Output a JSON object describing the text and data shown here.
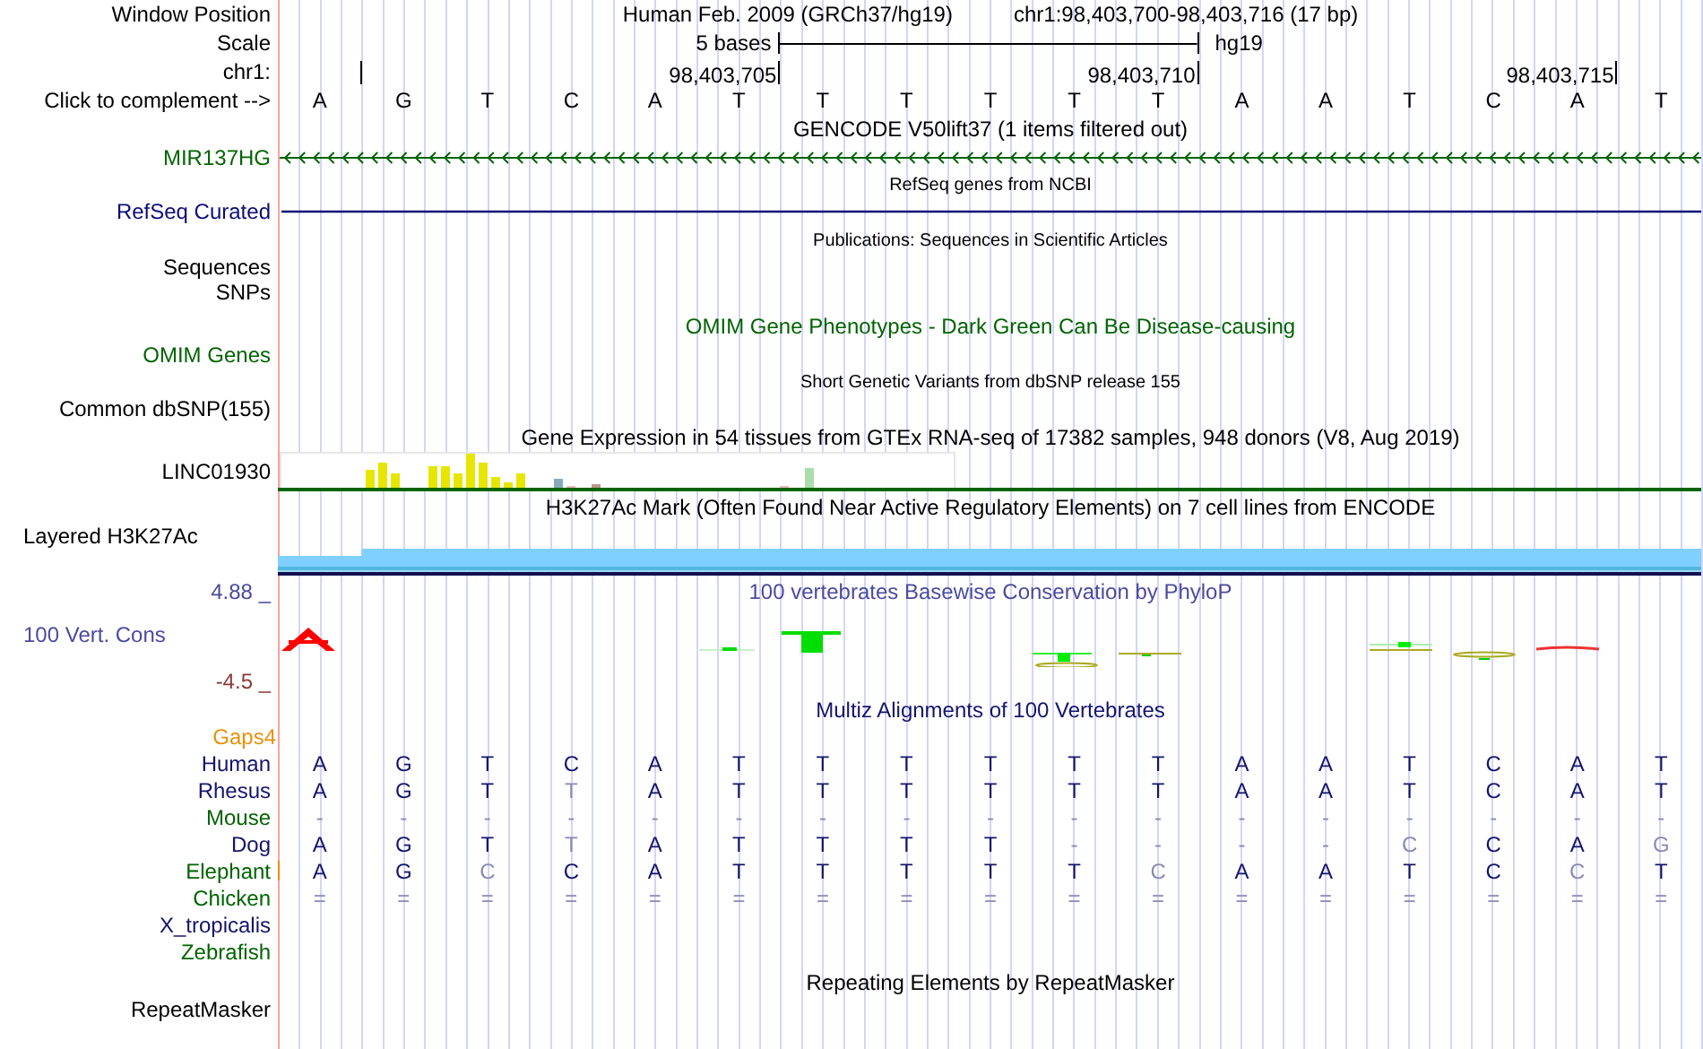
{
  "header": {
    "label": "Window Position",
    "assembly": "Human Feb. 2009 (GRCh37/hg19)",
    "position": "chr1:98,403,700-98,403,716 (17 bp)"
  },
  "scale": {
    "label": "Scale",
    "span": "5 bases",
    "assembly": "hg19"
  },
  "ruler": {
    "label": "chr1:",
    "ticks": [
      "98,403,705",
      "98,403,710",
      "98,403,715"
    ]
  },
  "sequence": {
    "label": "Click to complement -->",
    "bases": [
      "A",
      "G",
      "T",
      "C",
      "A",
      "T",
      "T",
      "T",
      "T",
      "T",
      "T",
      "A",
      "A",
      "T",
      "C",
      "A",
      "T"
    ]
  },
  "tracks": [
    {
      "kind": "gene",
      "title": "GENCODE V50lift37 (1 items filtered out)",
      "color": "#000000",
      "labels": [
        {
          "text": "MIR137HG",
          "color": "#006400"
        }
      ]
    },
    {
      "kind": "refseq",
      "title": "RefSeq genes from NCBI",
      "color": "#000000",
      "labels": [
        {
          "text": "RefSeq Curated",
          "color": "#0c0c78"
        }
      ]
    },
    {
      "kind": "pubs",
      "title": "Publications: Sequences in Scientific Articles",
      "color": "#000000",
      "labels": [
        {
          "text": "Sequences",
          "color": "#000000"
        },
        {
          "text": "SNPs",
          "color": "#000000"
        }
      ]
    },
    {
      "kind": "omim",
      "title": "OMIM Gene Phenotypes - Dark Green Can Be Disease-causing",
      "color": "#006400",
      "labels": [
        {
          "text": "OMIM Genes",
          "color": "#006400"
        }
      ]
    },
    {
      "kind": "dbsnp",
      "title": "Short Genetic Variants from dbSNP release 155",
      "color": "#000000",
      "labels": [
        {
          "text": "Common dbSNP(155)",
          "color": "#000000"
        }
      ]
    },
    {
      "kind": "gtex",
      "title": "Gene Expression in 54 tissues from GTEx RNA-seq of 17382 samples, 948 donors (V8, Aug 2019)",
      "color": "#000000",
      "labels": [
        {
          "text": "LINC01930",
          "color": "#000000"
        }
      ]
    },
    {
      "kind": "h3k27ac",
      "title": "H3K27Ac Mark (Often Found Near Active Regulatory Elements) on 7 cell lines from ENCODE",
      "color": "#000000",
      "labels": [
        {
          "text": "Layered H3K27Ac",
          "color": "#000000"
        }
      ]
    },
    {
      "kind": "phylop",
      "title": "100 vertebrates Basewise Conservation by PhyloP",
      "color": "#4a4aa0",
      "labels": [
        {
          "text": "4.88 _",
          "color": "#4a4aa0"
        },
        {
          "text": "100 Vert. Cons",
          "color": "#4a4aa0"
        },
        {
          "text": "-4.5 _",
          "color": "#8a3a3a"
        }
      ]
    },
    {
      "kind": "multiz",
      "title": "Multiz Alignments of 100 Vertebrates",
      "color": "#14146e",
      "labels": [
        {
          "text": "Gaps4",
          "color": "#e8900a"
        }
      ],
      "species": [
        {
          "name": "Human",
          "color": "#14146e",
          "gap": false,
          "bases": [
            {
              "b": "A",
              "dim": false
            },
            {
              "b": "G",
              "dim": false
            },
            {
              "b": "T",
              "dim": false
            },
            {
              "b": "C",
              "dim": false
            },
            {
              "b": "A",
              "dim": false
            },
            {
              "b": "T",
              "dim": false
            },
            {
              "b": "T",
              "dim": false
            },
            {
              "b": "T",
              "dim": false
            },
            {
              "b": "T",
              "dim": false
            },
            {
              "b": "T",
              "dim": false
            },
            {
              "b": "T",
              "dim": false
            },
            {
              "b": "A",
              "dim": false
            },
            {
              "b": "A",
              "dim": false
            },
            {
              "b": "T",
              "dim": false
            },
            {
              "b": "C",
              "dim": false
            },
            {
              "b": "A",
              "dim": false
            },
            {
              "b": "T",
              "dim": false
            }
          ]
        },
        {
          "name": "Rhesus",
          "color": "#14146e",
          "gap": false,
          "bases": [
            {
              "b": "A",
              "dim": false
            },
            {
              "b": "G",
              "dim": false
            },
            {
              "b": "T",
              "dim": false
            },
            {
              "b": "T",
              "dim": true
            },
            {
              "b": "A",
              "dim": false
            },
            {
              "b": "T",
              "dim": false
            },
            {
              "b": "T",
              "dim": false
            },
            {
              "b": "T",
              "dim": false
            },
            {
              "b": "T",
              "dim": false
            },
            {
              "b": "T",
              "dim": false
            },
            {
              "b": "T",
              "dim": false
            },
            {
              "b": "A",
              "dim": false
            },
            {
              "b": "A",
              "dim": false
            },
            {
              "b": "T",
              "dim": false
            },
            {
              "b": "C",
              "dim": false
            },
            {
              "b": "A",
              "dim": false
            },
            {
              "b": "T",
              "dim": false
            }
          ]
        },
        {
          "name": "Mouse",
          "color": "#006400",
          "gap": false,
          "bases": [
            {
              "b": "-",
              "dim": true
            },
            {
              "b": "-",
              "dim": true
            },
            {
              "b": "-",
              "dim": true
            },
            {
              "b": "-",
              "dim": true
            },
            {
              "b": "-",
              "dim": true
            },
            {
              "b": "-",
              "dim": true
            },
            {
              "b": "-",
              "dim": true
            },
            {
              "b": "-",
              "dim": true
            },
            {
              "b": "-",
              "dim": true
            },
            {
              "b": "-",
              "dim": true
            },
            {
              "b": "-",
              "dim": true
            },
            {
              "b": "-",
              "dim": true
            },
            {
              "b": "-",
              "dim": true
            },
            {
              "b": "-",
              "dim": true
            },
            {
              "b": "-",
              "dim": true
            },
            {
              "b": "-",
              "dim": true
            },
            {
              "b": "-",
              "dim": true
            }
          ]
        },
        {
          "name": "Dog",
          "color": "#14146e",
          "gap": false,
          "bases": [
            {
              "b": "A",
              "dim": false
            },
            {
              "b": "G",
              "dim": false
            },
            {
              "b": "T",
              "dim": false
            },
            {
              "b": "T",
              "dim": true
            },
            {
              "b": "A",
              "dim": false
            },
            {
              "b": "T",
              "dim": false
            },
            {
              "b": "T",
              "dim": false
            },
            {
              "b": "T",
              "dim": false
            },
            {
              "b": "T",
              "dim": false
            },
            {
              "b": "-",
              "dim": true
            },
            {
              "b": "-",
              "dim": true
            },
            {
              "b": "-",
              "dim": true
            },
            {
              "b": "-",
              "dim": true
            },
            {
              "b": "C",
              "dim": true
            },
            {
              "b": "C",
              "dim": false
            },
            {
              "b": "A",
              "dim": false
            },
            {
              "b": "G",
              "dim": true
            }
          ]
        },
        {
          "name": "Elephant",
          "color": "#006400",
          "gap": true,
          "bases": [
            {
              "b": "A",
              "dim": false
            },
            {
              "b": "G",
              "dim": false
            },
            {
              "b": "C",
              "dim": true
            },
            {
              "b": "C",
              "dim": false
            },
            {
              "b": "A",
              "dim": false
            },
            {
              "b": "T",
              "dim": false
            },
            {
              "b": "T",
              "dim": false
            },
            {
              "b": "T",
              "dim": false
            },
            {
              "b": "T",
              "dim": false
            },
            {
              "b": "T",
              "dim": false
            },
            {
              "b": "C",
              "dim": true
            },
            {
              "b": "A",
              "dim": false
            },
            {
              "b": "A",
              "dim": false
            },
            {
              "b": "T",
              "dim": false
            },
            {
              "b": "C",
              "dim": false
            },
            {
              "b": "C",
              "dim": true
            },
            {
              "b": "T",
              "dim": false
            }
          ]
        },
        {
          "name": "Chicken",
          "color": "#006400",
          "gap": false,
          "bases": [
            {
              "b": "=",
              "dim": true
            },
            {
              "b": "=",
              "dim": true
            },
            {
              "b": "=",
              "dim": true
            },
            {
              "b": "=",
              "dim": true
            },
            {
              "b": "=",
              "dim": true
            },
            {
              "b": "=",
              "dim": true
            },
            {
              "b": "=",
              "dim": true
            },
            {
              "b": "=",
              "dim": true
            },
            {
              "b": "=",
              "dim": true
            },
            {
              "b": "=",
              "dim": true
            },
            {
              "b": "=",
              "dim": true
            },
            {
              "b": "=",
              "dim": true
            },
            {
              "b": "=",
              "dim": true
            },
            {
              "b": "=",
              "dim": true
            },
            {
              "b": "=",
              "dim": true
            },
            {
              "b": "=",
              "dim": true
            },
            {
              "b": "=",
              "dim": true
            }
          ]
        },
        {
          "name": "X_tropicalis",
          "color": "#14146e",
          "gap": false
        },
        {
          "name": "Zebrafish",
          "color": "#006400",
          "gap": false
        }
      ]
    },
    {
      "kind": "rmsk",
      "title": "Repeating Elements by RepeatMasker",
      "color": "#000000",
      "labels": [
        {
          "text": "RepeatMasker",
          "color": "#000000"
        }
      ]
    }
  ]
}
